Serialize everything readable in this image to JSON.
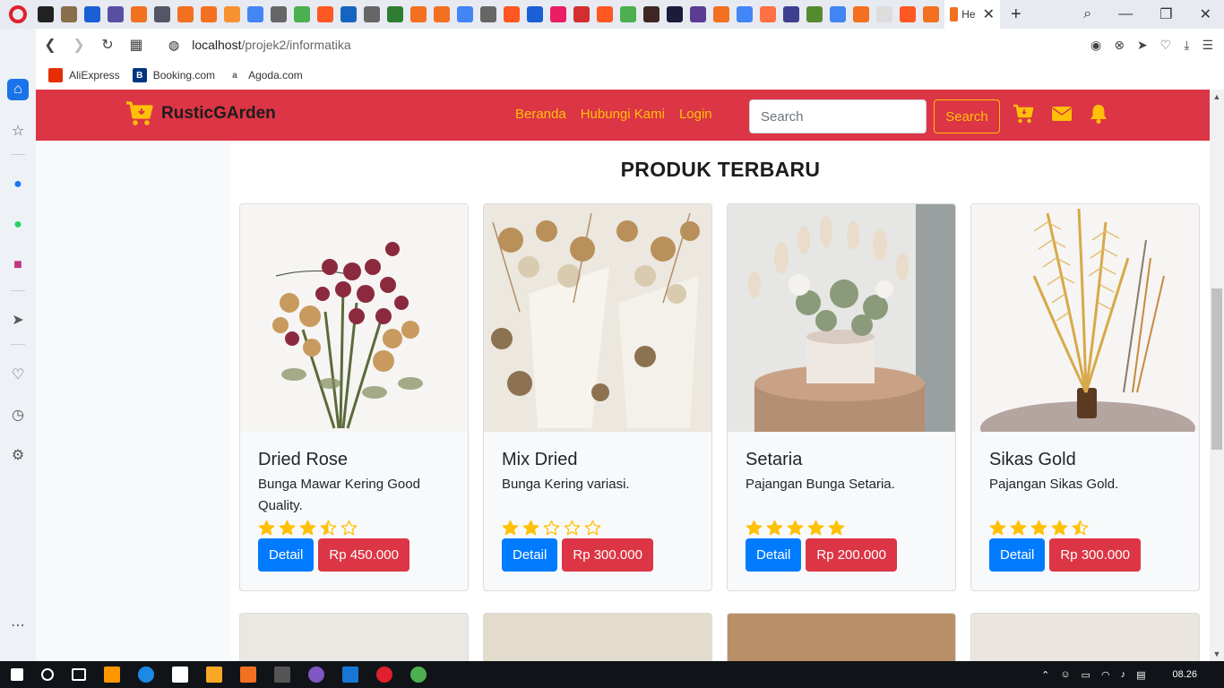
{
  "browser": {
    "active_tab_label": "He",
    "url_host": "localhost",
    "url_path": "/projek2/informatika",
    "bookmarks": [
      {
        "label": "AliExpress",
        "color": "#e62e04"
      },
      {
        "label": "Booking.com",
        "color": "#003580"
      },
      {
        "label": "Agoda.com",
        "color": "#7a7a7a"
      }
    ]
  },
  "navbar": {
    "brand": "RusticGArden",
    "links": [
      "Beranda",
      "Hubungi Kami",
      "Login"
    ],
    "search_placeholder": "Search",
    "search_button": "Search",
    "accent_color": "#dc3545",
    "link_color": "#ffc107"
  },
  "section": {
    "title": "PRODUK TERBARU"
  },
  "products": [
    {
      "name": "Dried Rose",
      "desc": "Bunga Mawar Kering Good Quality.",
      "rating": 3.5,
      "detail": "Detail",
      "price": "Rp 450.000"
    },
    {
      "name": "Mix Dried",
      "desc": "Bunga Kering variasi.",
      "rating": 2,
      "detail": "Detail",
      "price": "Rp 300.000"
    },
    {
      "name": "Setaria",
      "desc": "Pajangan Bunga Setaria.",
      "rating": 5,
      "detail": "Detail",
      "price": "Rp 200.000"
    },
    {
      "name": "Sikas Gold",
      "desc": "Pajangan Sikas Gold.",
      "rating": 4.5,
      "detail": "Detail",
      "price": "Rp 300.000"
    }
  ],
  "taskbar": {
    "time": "08.26"
  }
}
